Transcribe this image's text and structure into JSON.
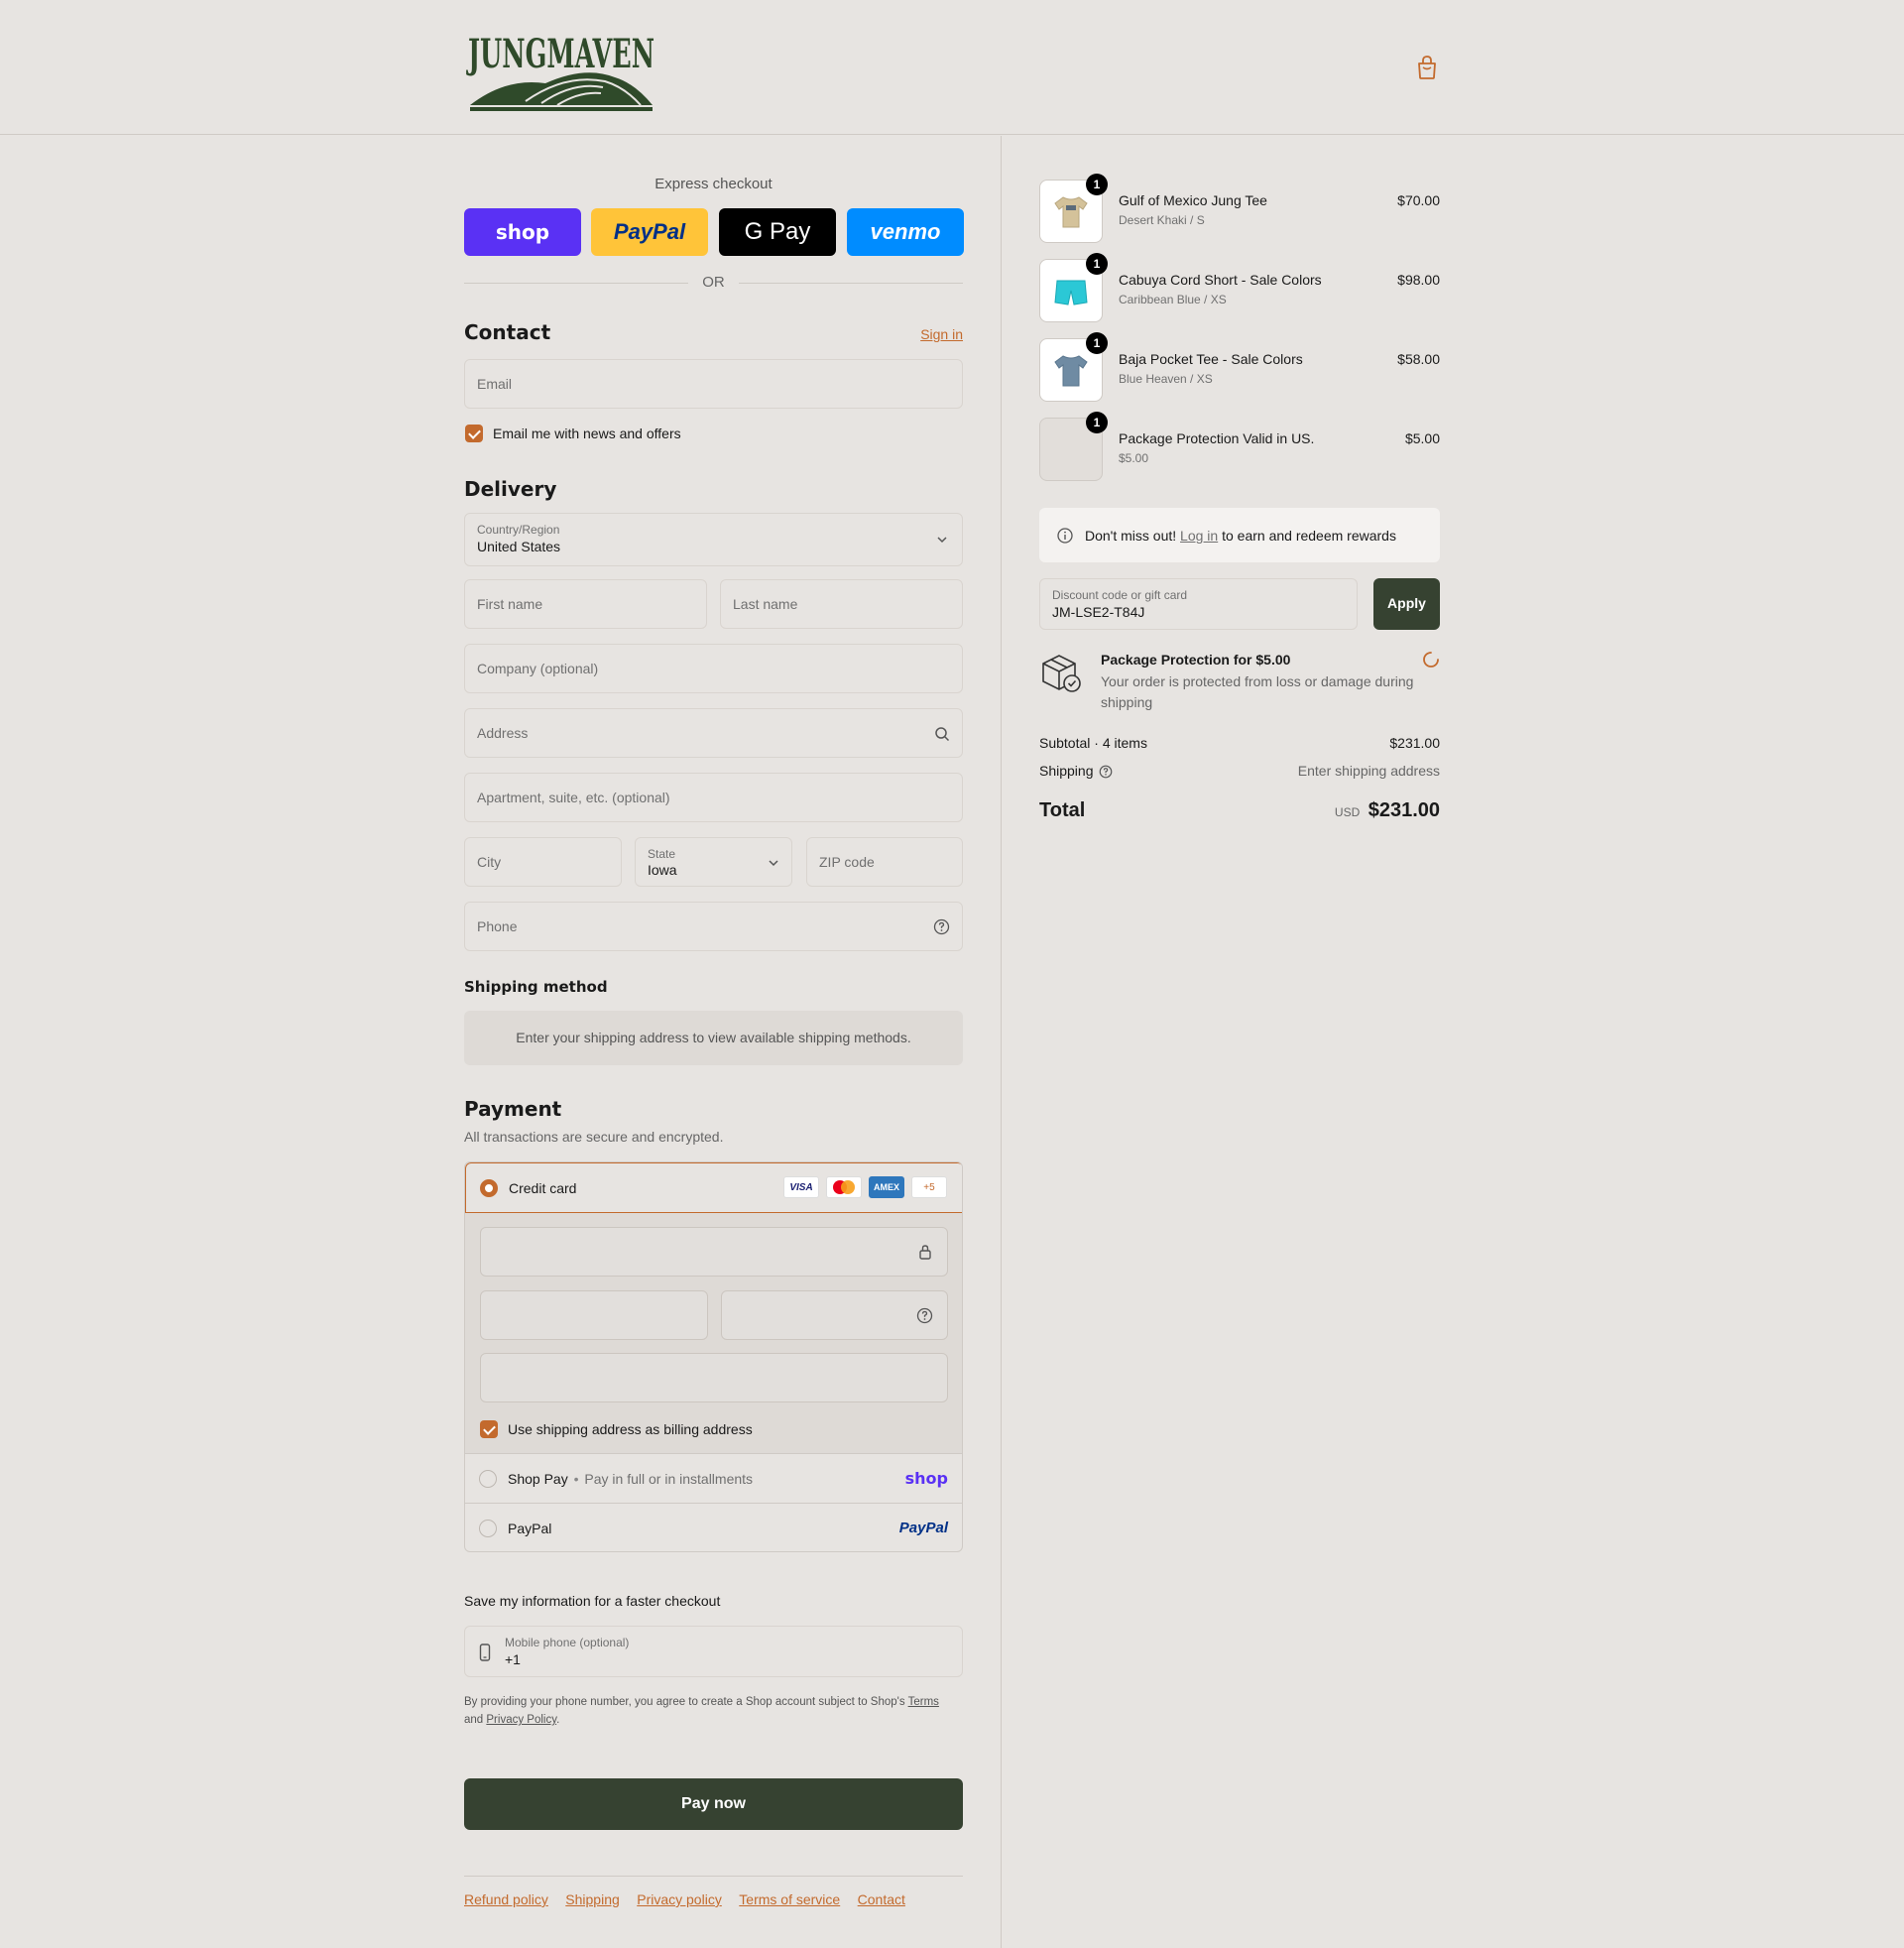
{
  "header": {
    "brand": "JUNGMAVEN"
  },
  "express": {
    "title": "Express checkout",
    "buttons": [
      {
        "label": "shop",
        "bg": "#5a31f4",
        "color": "#ffffff"
      },
      {
        "label": "PayPal",
        "bg": "#ffc439",
        "color": "#003087"
      },
      {
        "label": "G Pay",
        "bg": "#000000",
        "color": "#ffffff"
      },
      {
        "label": "venmo",
        "bg": "#008cff",
        "color": "#ffffff"
      }
    ],
    "or": "OR"
  },
  "contact": {
    "title": "Contact",
    "sign_in": "Sign in",
    "email_placeholder": "Email",
    "news_label": "Email me with news and offers"
  },
  "delivery": {
    "title": "Delivery",
    "country_label": "Country/Region",
    "country_value": "United States",
    "first_name": "First name",
    "last_name": "Last name",
    "company": "Company (optional)",
    "address": "Address",
    "apartment": "Apartment, suite, etc. (optional)",
    "city": "City",
    "state_label": "State",
    "state_value": "Iowa",
    "zip": "ZIP code",
    "phone": "Phone"
  },
  "shipping_method": {
    "title": "Shipping method",
    "message": "Enter your shipping address to view available shipping methods."
  },
  "payment": {
    "title": "Payment",
    "subtitle": "All transactions are secure and encrypted.",
    "credit_card": "Credit card",
    "card_logos": [
      "VISA",
      "MC",
      "AMEX",
      "+5"
    ],
    "billing_label": "Use shipping address as billing address",
    "shop_pay": "Shop Pay",
    "shop_pay_sub": "Pay in full or in installments",
    "shop_pay_logo": "shop",
    "paypal": "PayPal",
    "paypal_logo": "PayPal"
  },
  "save_info": {
    "title": "Save my information for a faster checkout",
    "mobile_label": "Mobile phone (optional)",
    "mobile_value": "+1",
    "disclaimer_a": "By providing your phone number, you agree to create a Shop account subject to Shop's",
    "terms": "Terms",
    "and": "and",
    "privacy": "Privacy Policy",
    "period": "."
  },
  "pay_now": "Pay now",
  "footer": {
    "links": [
      "Refund policy",
      "Shipping",
      "Privacy policy",
      "Terms of service",
      "Contact"
    ]
  },
  "cart": {
    "items": [
      {
        "name": "Gulf of Mexico Jung Tee",
        "variant": "Desert Khaki / S",
        "price": "$70.00",
        "qty": "1"
      },
      {
        "name": "Cabuya Cord Short - Sale Colors",
        "variant": "Caribbean Blue / XS",
        "price": "$98.00",
        "qty": "1"
      },
      {
        "name": "Baja Pocket Tee - Sale Colors",
        "variant": "Blue Heaven / XS",
        "price": "$58.00",
        "qty": "1"
      },
      {
        "name": "Package Protection Valid in US.",
        "variant": "$5.00",
        "price": "$5.00",
        "qty": "1"
      }
    ],
    "rewards_a": "Don't miss out!",
    "rewards_link": "Log in",
    "rewards_b": "to earn and redeem rewards",
    "discount_label": "Discount code or gift card",
    "discount_value": "JM-LSE2-T84J",
    "apply": "Apply",
    "protection_title": "Package Protection for $5.00",
    "protection_text": "Your order is protected from loss or damage during shipping",
    "subtotal_label": "Subtotal · 4 items",
    "subtotal_value": "$231.00",
    "shipping_label": "Shipping",
    "shipping_value": "Enter shipping address",
    "total_label": "Total",
    "currency": "USD",
    "total_value": "$231.00"
  }
}
